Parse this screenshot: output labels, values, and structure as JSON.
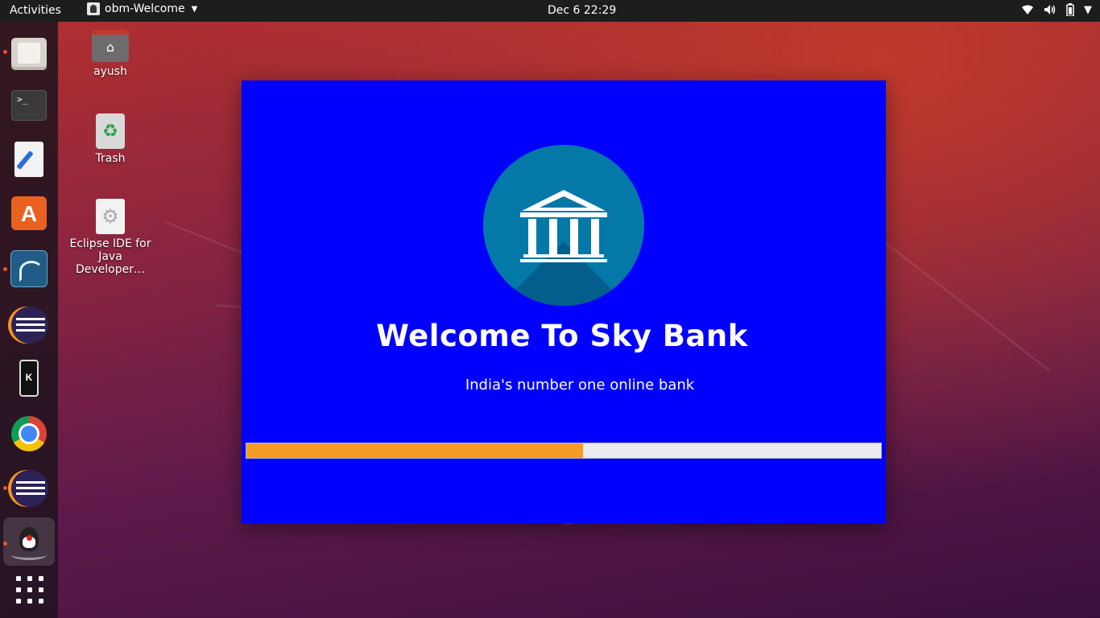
{
  "topbar": {
    "activities_label": "Activities",
    "app_name": "obm-Welcome",
    "clock": "Dec 6  22:29"
  },
  "dock": {
    "items": [
      {
        "name": "Files",
        "icon": "files-icon",
        "running": true
      },
      {
        "name": "Terminal",
        "icon": "terminal-icon",
        "running": false
      },
      {
        "name": "Text Editor",
        "icon": "text-editor-icon",
        "running": false
      },
      {
        "name": "Ubuntu Software",
        "icon": "software-store-icon",
        "running": false
      },
      {
        "name": "MySQL Workbench",
        "icon": "mysql-workbench-icon",
        "running": true
      },
      {
        "name": "Eclipse",
        "icon": "eclipse-icon",
        "running": false
      },
      {
        "name": "KDE Connect",
        "icon": "kde-connect-icon",
        "running": false
      },
      {
        "name": "Google Chrome",
        "icon": "chrome-icon",
        "running": false
      },
      {
        "name": "Eclipse",
        "icon": "eclipse-icon",
        "running": true
      },
      {
        "name": "Java",
        "icon": "java-duke-icon",
        "running": true
      },
      {
        "name": "Show Applications",
        "icon": "app-grid-icon",
        "running": false
      }
    ],
    "terminal_glyph": ">_",
    "store_glyph": "A",
    "kde_glyph": "K"
  },
  "desktop": {
    "icons": [
      {
        "label": "ayush",
        "icon": "home-folder-icon"
      },
      {
        "label": "Trash",
        "icon": "trash-icon"
      },
      {
        "label": "Eclipse IDE for Java Developer…",
        "icon": "eclipse-launcher-icon"
      }
    ]
  },
  "splash": {
    "title": "Welcome To Sky Bank",
    "subtitle": "India's number one online bank",
    "progress_percent": 53,
    "colors": {
      "background": "#0000ff",
      "logo_circle": "#0479a8",
      "progress_fill": "#f39c26",
      "progress_track": "#ececec"
    }
  }
}
